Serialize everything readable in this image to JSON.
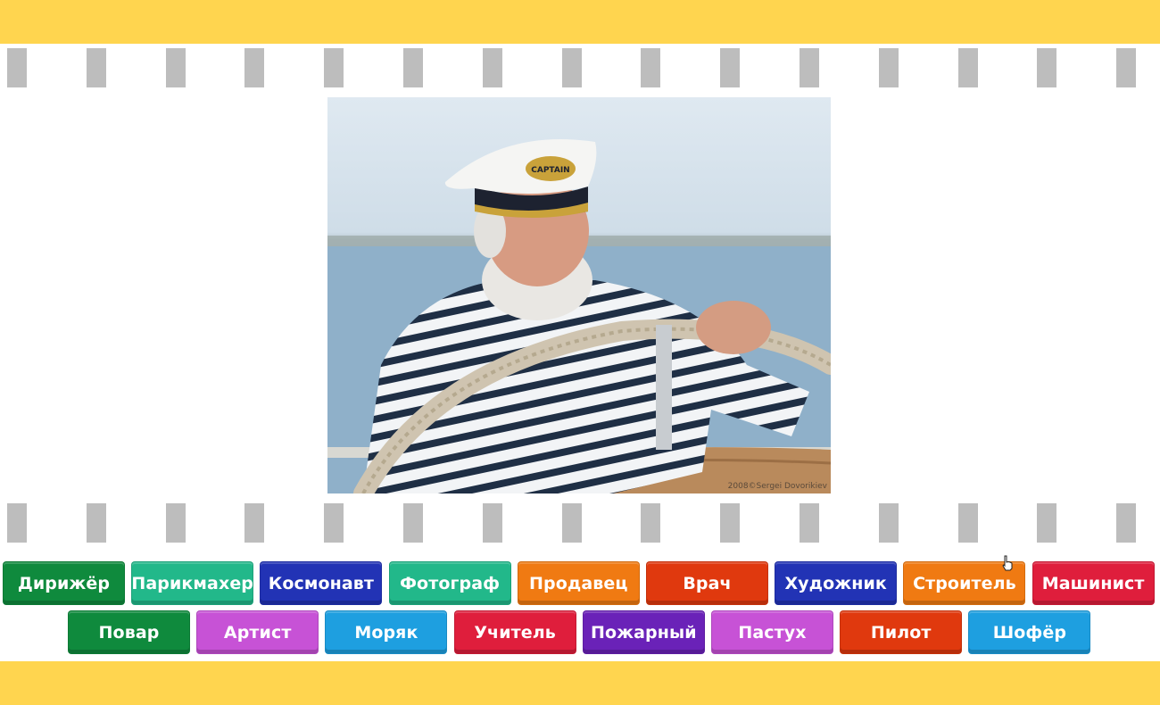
{
  "photo": {
    "alt": "captain-at-helm",
    "cap_text": "CAPTAIN",
    "credit": "2008©Sergei Dovorikiev"
  },
  "answers_row1": [
    {
      "label": "Дирижёр",
      "color": "#0f8a3d"
    },
    {
      "label": "Парикмахер",
      "color": "#22b88a"
    },
    {
      "label": "Космонавт",
      "color": "#2233b5"
    },
    {
      "label": "Фотограф",
      "color": "#22b88a"
    },
    {
      "label": "Продавец",
      "color": "#f07a12"
    },
    {
      "label": "Врач",
      "color": "#e0390e"
    },
    {
      "label": "Художник",
      "color": "#2233b5"
    },
    {
      "label": "Строитель",
      "color": "#f07a12"
    },
    {
      "label": "Машинист",
      "color": "#df1e3c"
    }
  ],
  "answers_row2": [
    {
      "label": "Повар",
      "color": "#0f8a3d"
    },
    {
      "label": "Артист",
      "color": "#c752d6"
    },
    {
      "label": "Моряк",
      "color": "#1e9fe0"
    },
    {
      "label": "Учитель",
      "color": "#df1e3c"
    },
    {
      "label": "Пожарный",
      "color": "#6a22b8"
    },
    {
      "label": "Пастух",
      "color": "#c752d6"
    },
    {
      "label": "Пилот",
      "color": "#e0390e"
    },
    {
      "label": "Шофёр",
      "color": "#1e9fe0"
    }
  ]
}
